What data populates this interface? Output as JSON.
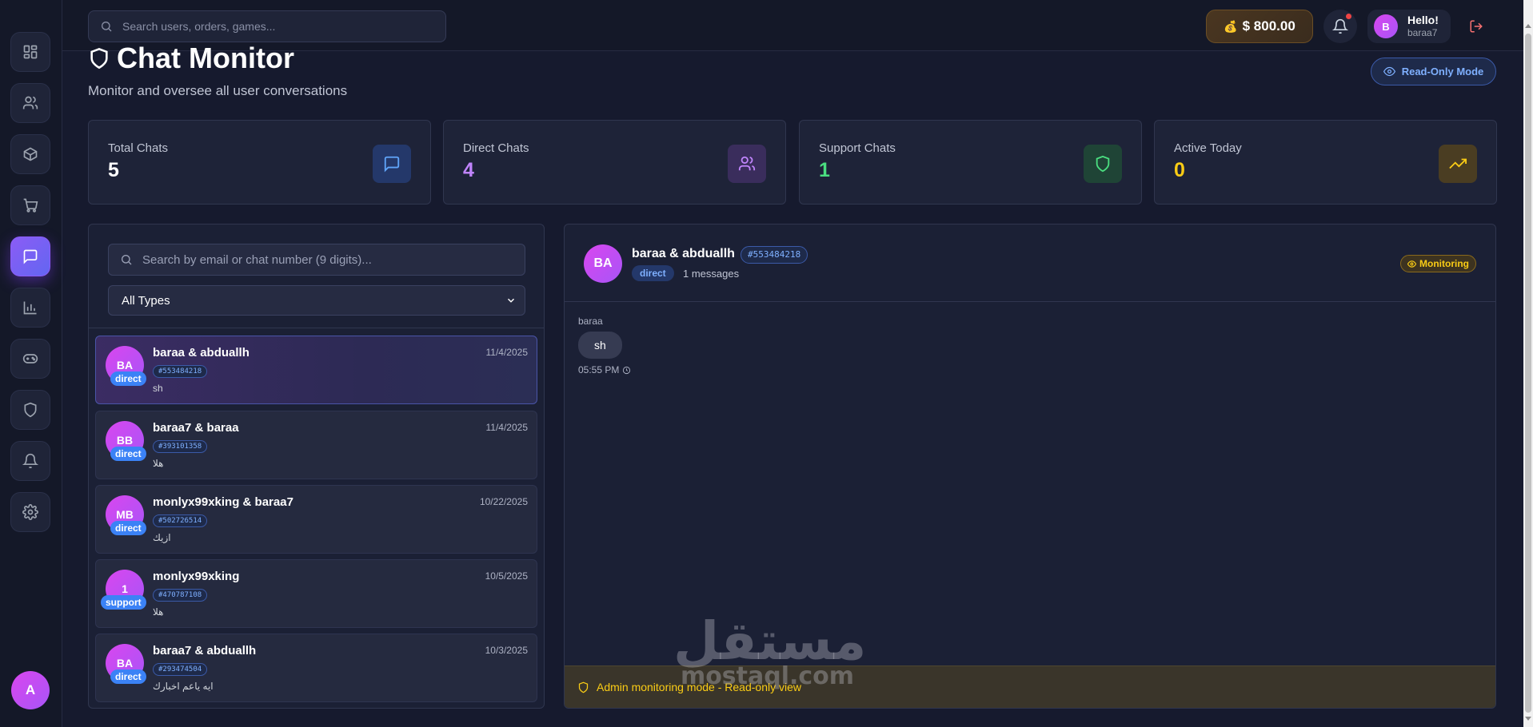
{
  "topbar": {
    "search_placeholder": "Search users, orders, games...",
    "balance": "$ 800.00",
    "balance_icon": "money-bag",
    "greeting": "Hello!",
    "username": "baraa7",
    "user_initial": "B"
  },
  "sidebar": {
    "items": [
      {
        "icon": "dashboard-icon"
      },
      {
        "icon": "users-icon"
      },
      {
        "icon": "package-icon"
      },
      {
        "icon": "cart-icon"
      },
      {
        "icon": "chat-icon",
        "active": true
      },
      {
        "icon": "analytics-icon"
      },
      {
        "icon": "gamepad-icon"
      },
      {
        "icon": "shield-icon"
      },
      {
        "icon": "bell-icon"
      },
      {
        "icon": "settings-icon"
      }
    ],
    "avatar_initial": "A"
  },
  "page": {
    "title": "Chat Monitor",
    "subtitle": "Monitor and oversee all user conversations",
    "readonly_label": "Read-Only Mode"
  },
  "stats": [
    {
      "label": "Total Chats",
      "value": "5",
      "color": "#ffffff",
      "icon": "chat-icon"
    },
    {
      "label": "Direct Chats",
      "value": "4",
      "color": "#c084fc",
      "icon": "users-icon"
    },
    {
      "label": "Support Chats",
      "value": "1",
      "color": "#4ade80",
      "icon": "shield-icon"
    },
    {
      "label": "Active Today",
      "value": "0",
      "color": "#facc15",
      "icon": "trending-up-icon"
    }
  ],
  "chat_list": {
    "search_placeholder": "Search by email or chat number (9 digits)...",
    "type_filter": "All Types",
    "items": [
      {
        "initials": "BA",
        "type": "direct",
        "name": "baraa & abduallh",
        "date": "11/4/2025",
        "number": "#553484218",
        "last_message": "sh"
      },
      {
        "initials": "BB",
        "type": "direct",
        "name": "baraa7 & baraa",
        "date": "11/4/2025",
        "number": "#393101358",
        "last_message": "هلا"
      },
      {
        "initials": "MB",
        "type": "direct",
        "name": "monlyx99xking & baraa7",
        "date": "10/22/2025",
        "number": "#502726514",
        "last_message": "ازيك"
      },
      {
        "initials": "1",
        "type": "support",
        "name": "monlyx99xking",
        "date": "10/5/2025",
        "number": "#470787108",
        "last_message": "هلا"
      },
      {
        "initials": "BA",
        "type": "direct",
        "name": "baraa7 & abduallh",
        "date": "10/3/2025",
        "number": "#293474504",
        "last_message": "ايه ياعم اخبارك"
      }
    ]
  },
  "conversation": {
    "initials": "BA",
    "name": "baraa & abduallh",
    "number": "#553484218",
    "type": "direct",
    "message_count": "1 messages",
    "monitoring_label": "Monitoring",
    "messages": [
      {
        "sender": "baraa",
        "text": "sh",
        "time": "05:55 PM"
      }
    ],
    "footer": "Admin monitoring mode - Read-only view"
  },
  "watermark": {
    "arabic": "مستقل",
    "latin": "mostaql.com"
  }
}
